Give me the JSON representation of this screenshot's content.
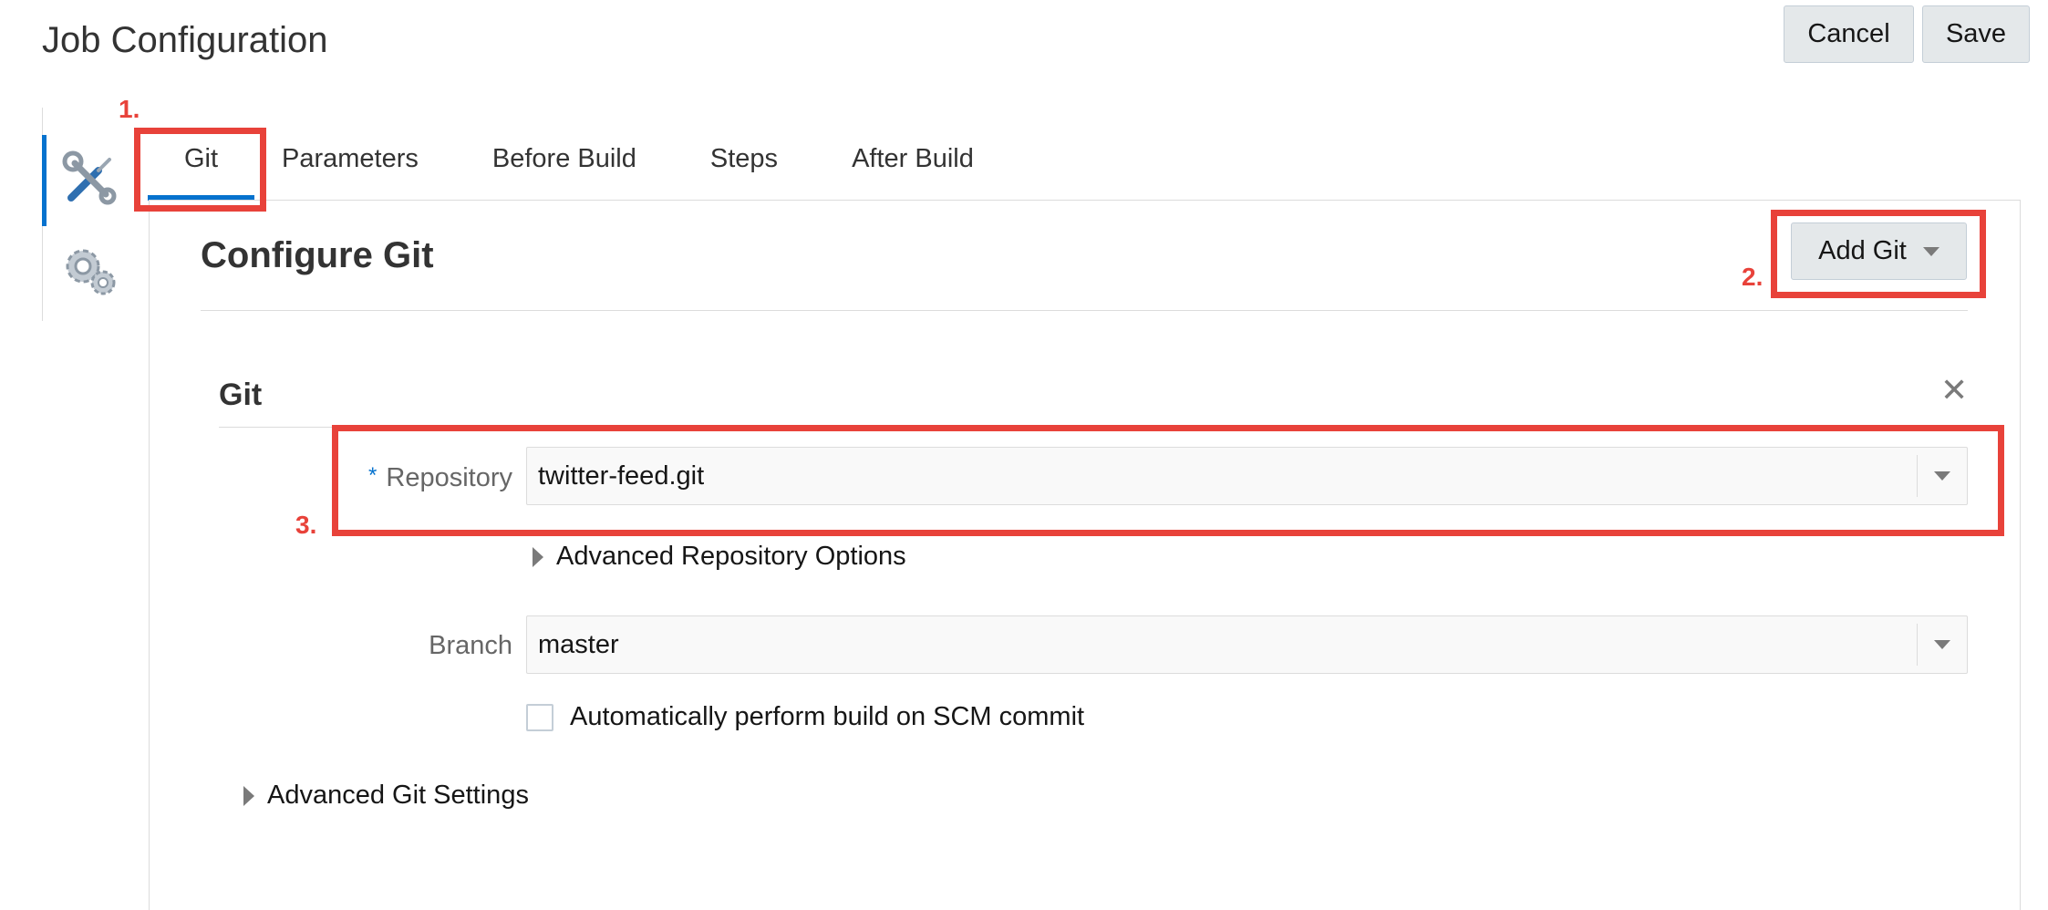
{
  "page": {
    "title": "Job Configuration"
  },
  "header": {
    "cancel_label": "Cancel",
    "save_label": "Save"
  },
  "side_nav": {
    "items": [
      {
        "icon": "tools-icon",
        "active": true
      },
      {
        "icon": "gears-icon",
        "active": false
      }
    ]
  },
  "tabs": [
    "Git",
    "Parameters",
    "Before Build",
    "Steps",
    "After Build"
  ],
  "section": {
    "title": "Configure Git",
    "add_button_label": "Add Git"
  },
  "git_block": {
    "title": "Git",
    "close_glyph": "✕",
    "repository": {
      "required_mark": "*",
      "label": "Repository",
      "value": "twitter-feed.git"
    },
    "advanced_repo_options": "Advanced Repository Options",
    "branch": {
      "label": "Branch",
      "value": "master"
    },
    "auto_build": {
      "label": "Automatically perform build on SCM commit",
      "checked": false
    },
    "advanced_git_settings": "Advanced Git Settings"
  },
  "annotations": [
    "1.",
    "2.",
    "3."
  ],
  "colors": {
    "accent": "#0572ce",
    "annotation": "#e8423a",
    "button_bg": "#e4e8ea"
  }
}
